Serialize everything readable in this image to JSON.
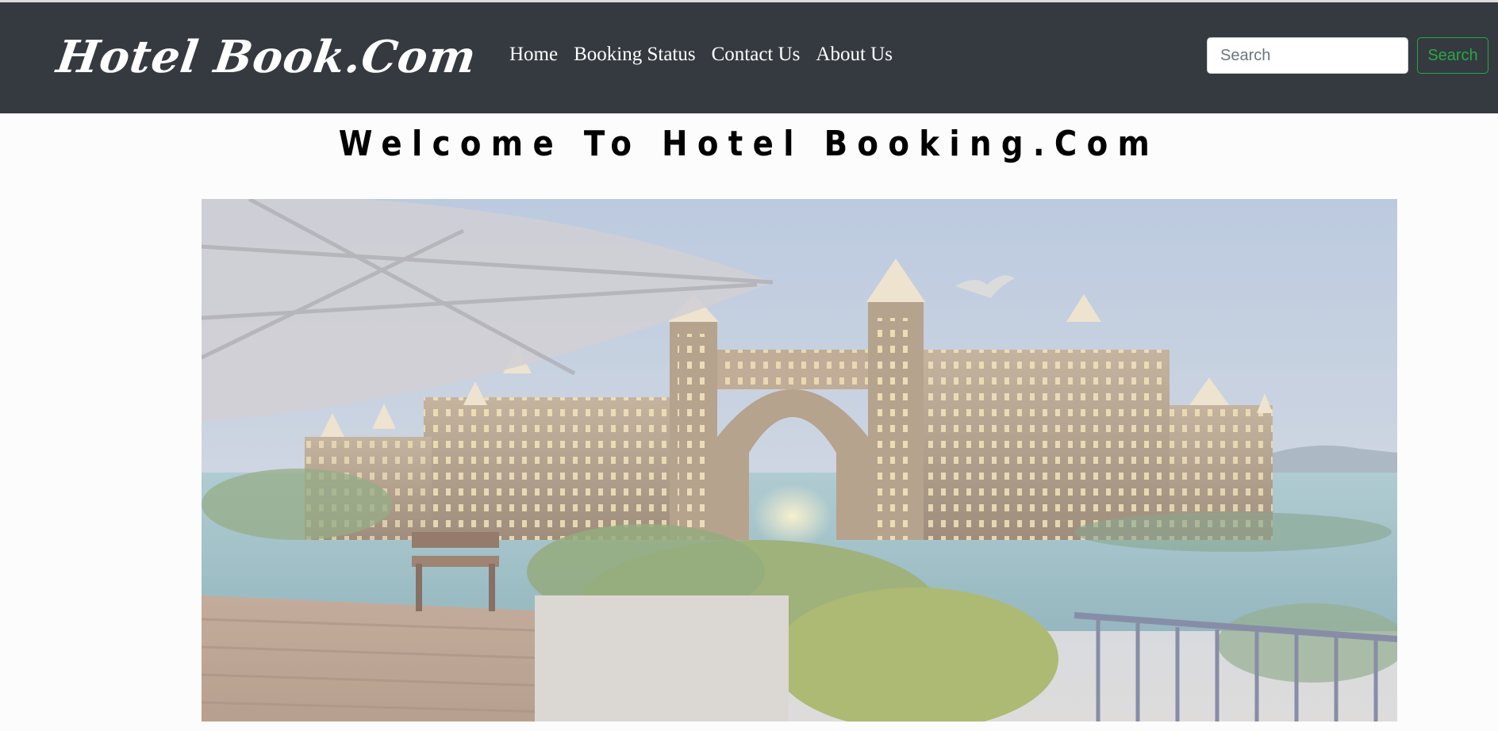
{
  "navbar": {
    "brand": "Hotel Book.Com",
    "links": [
      "Home",
      "Booking Status",
      "Contact Us",
      "About Us"
    ],
    "search": {
      "placeholder": "Search",
      "value": "",
      "button_label": "Search"
    }
  },
  "main": {
    "heading": "Welcome To Hotel Booking.Com"
  },
  "colors": {
    "navbar_bg": "#343a40",
    "search_accent": "#28a745",
    "page_bg": "#fcfcfc"
  }
}
